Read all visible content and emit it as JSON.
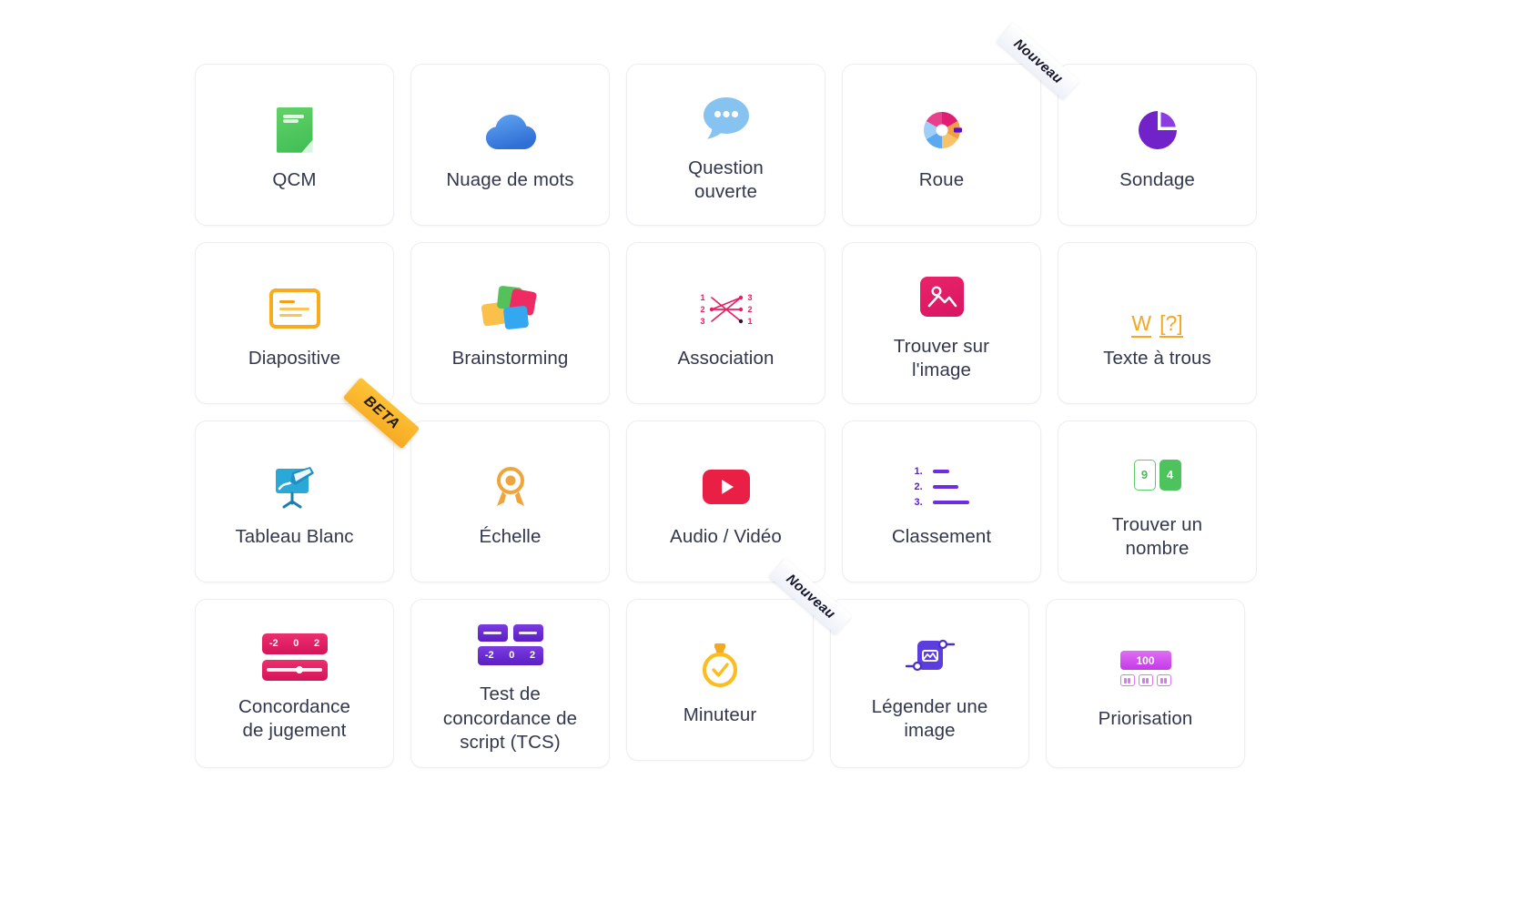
{
  "page": {
    "background_color": "#ffffff",
    "text_color": "#33374d"
  },
  "badges": {
    "nouveau": "Nouveau",
    "beta": "BETA"
  },
  "grid": {
    "rows": [
      {
        "cards": [
          {
            "label": "QCM",
            "icon": "document-green-icon",
            "badge": null
          },
          {
            "label": "Nuage de mots",
            "icon": "cloud-blue-icon",
            "badge": null
          },
          {
            "label": "Question\nouverte",
            "icon": "speech-bubble-icon",
            "badge": null
          },
          {
            "label": "Roue",
            "icon": "donut-wheel-icon",
            "badge": "Nouveau"
          },
          {
            "label": "Sondage",
            "icon": "pie-chart-icon",
            "badge": null
          }
        ]
      },
      {
        "cards": [
          {
            "label": "Diapositive",
            "icon": "slide-icon",
            "badge": null
          },
          {
            "label": "Brainstorming",
            "icon": "sticky-notes-icon",
            "badge": null
          },
          {
            "label": "Association",
            "icon": "matching-lines-icon",
            "badge": null
          },
          {
            "label": "Trouver sur\nl'image",
            "icon": "image-pin-icon",
            "badge": null
          },
          {
            "label": "Texte à trous",
            "icon": "fill-in-blank-icon",
            "badge": null
          }
        ]
      },
      {
        "cards": [
          {
            "label": "Tableau Blanc",
            "icon": "whiteboard-icon",
            "badge": "BETA"
          },
          {
            "label": "Échelle",
            "icon": "medal-icon",
            "badge": null
          },
          {
            "label": "Audio / Vidéo",
            "icon": "video-play-icon",
            "badge": null
          },
          {
            "label": "Classement",
            "icon": "ranking-list-icon",
            "badge": null
          },
          {
            "label": "Trouver un\nnombre",
            "icon": "number-cards-icon",
            "badge": null
          }
        ]
      },
      {
        "cards": [
          {
            "label": "Concordance\nde jugement",
            "icon": "judgment-scale-icon",
            "badge": null
          },
          {
            "label": "Test de\nconcordance de\nscript (TCS)",
            "icon": "script-concordance-icon",
            "badge": null
          },
          {
            "label": "Minuteur",
            "icon": "stopwatch-icon",
            "badge": "Nouveau"
          },
          {
            "label": "Légender une\nimage",
            "icon": "image-caption-icon",
            "badge": null
          },
          {
            "label": "Priorisation",
            "icon": "prioritization-icon",
            "badge": null
          }
        ]
      }
    ]
  },
  "icon_text": {
    "association_left": [
      "1",
      "2",
      "3"
    ],
    "association_right": [
      "3",
      "2",
      "1"
    ],
    "fill_blank": [
      "W",
      "[?]"
    ],
    "ranking_numbers": [
      "1.",
      "2.",
      "3."
    ],
    "number_cards": [
      "9",
      "4"
    ],
    "concordance_scale": [
      "-2",
      "0",
      "2"
    ],
    "tcs_scale": [
      "-2",
      "0",
      "2"
    ],
    "prioritization_value": "100"
  }
}
